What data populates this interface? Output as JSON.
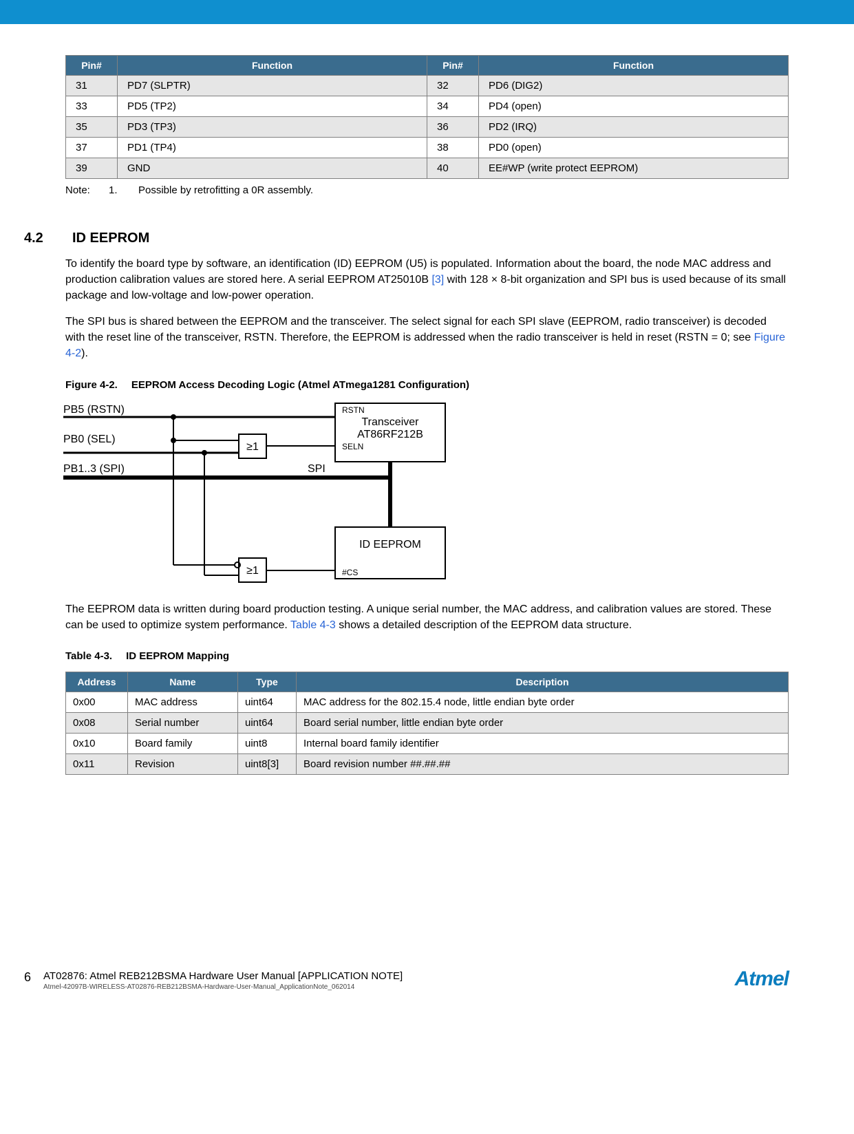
{
  "pintable": {
    "headers": [
      "Pin#",
      "Function",
      "Pin#",
      "Function"
    ],
    "rows": [
      [
        "31",
        "PD7 (SLPTR)",
        "32",
        "PD6 (DIG2)"
      ],
      [
        "33",
        "PD5 (TP2)",
        "34",
        "PD4 (open)"
      ],
      [
        "35",
        "PD3 (TP3)",
        "36",
        "PD2 (IRQ)"
      ],
      [
        "37",
        "PD1 (TP4)",
        "38",
        "PD0 (open)"
      ],
      [
        "39",
        "GND",
        "40",
        "EE#WP (write protect EEPROM)"
      ]
    ]
  },
  "note": {
    "label": "Note:",
    "num": "1.",
    "text": "Possible by retrofitting a 0R assembly."
  },
  "section": {
    "num": "4.2",
    "title": "ID EEPROM",
    "para1a": "To identify the board type by software, an identification (ID) EEPROM (U5) is populated. Information about the board, the node MAC address and production calibration values are stored here. A serial EEPROM AT25010B ",
    "para1ref": "[3]",
    "para1b": " with 128 × 8-bit organization and SPI bus is used because of its small package and low-voltage and low-power operation.",
    "para2a": "The SPI bus is shared between the EEPROM and the transceiver. The select signal for each SPI slave (EEPROM, radio transceiver) is decoded with the reset line of the transceiver, RSTN. Therefore, the EEPROM is addressed when the radio transceiver is held in reset (RSTN = 0; see ",
    "para2ref": "Figure 4-2",
    "para2b": ").",
    "para3a": "The EEPROM data is written during board production testing. A unique serial number, the MAC address, and calibration values are stored. These can be used to optimize system performance. ",
    "para3ref": "Table 4-3",
    "para3b": " shows a detailed description of the EEPROM data structure."
  },
  "figure": {
    "label": "Figure 4-2.",
    "title": "EEPROM Access Decoding Logic (Atmel ATmega1281 Configuration)",
    "pb5": "PB5 (RSTN)",
    "pb0": "PB0 (SEL)",
    "pb13": "PB1..3 (SPI)",
    "spi": "SPI",
    "ge1a": "≥1",
    "ge1b": "≥1",
    "rstn": "RSTN",
    "trx1": "Transceiver",
    "trx2": "AT86RF212B",
    "seln": "SELN",
    "ideeprom": "ID EEPROM",
    "cs": "#CS"
  },
  "table43": {
    "label": "Table 4-3.",
    "title": "ID EEPROM Mapping",
    "headers": [
      "Address",
      "Name",
      "Type",
      "Description"
    ],
    "rows": [
      [
        "0x00",
        "MAC address",
        "uint64",
        "MAC address for the 802.15.4 node, little endian byte order"
      ],
      [
        "0x08",
        "Serial number",
        "uint64",
        "Board serial number, little endian byte order"
      ],
      [
        "0x10",
        "Board family",
        "uint8",
        "Internal board family identifier"
      ],
      [
        "0x11",
        "Revision",
        "uint8[3]",
        "Board revision number ##.##.##"
      ]
    ]
  },
  "footer": {
    "pagenum": "6",
    "title": "AT02876: Atmel REB212BSMA Hardware User Manual [APPLICATION NOTE]",
    "sub": "Atmel-42097B-WIRELESS-AT02876-REB212BSMA-Hardware-User-Manual_ApplicationNote_062014",
    "logo": "Atmel"
  }
}
